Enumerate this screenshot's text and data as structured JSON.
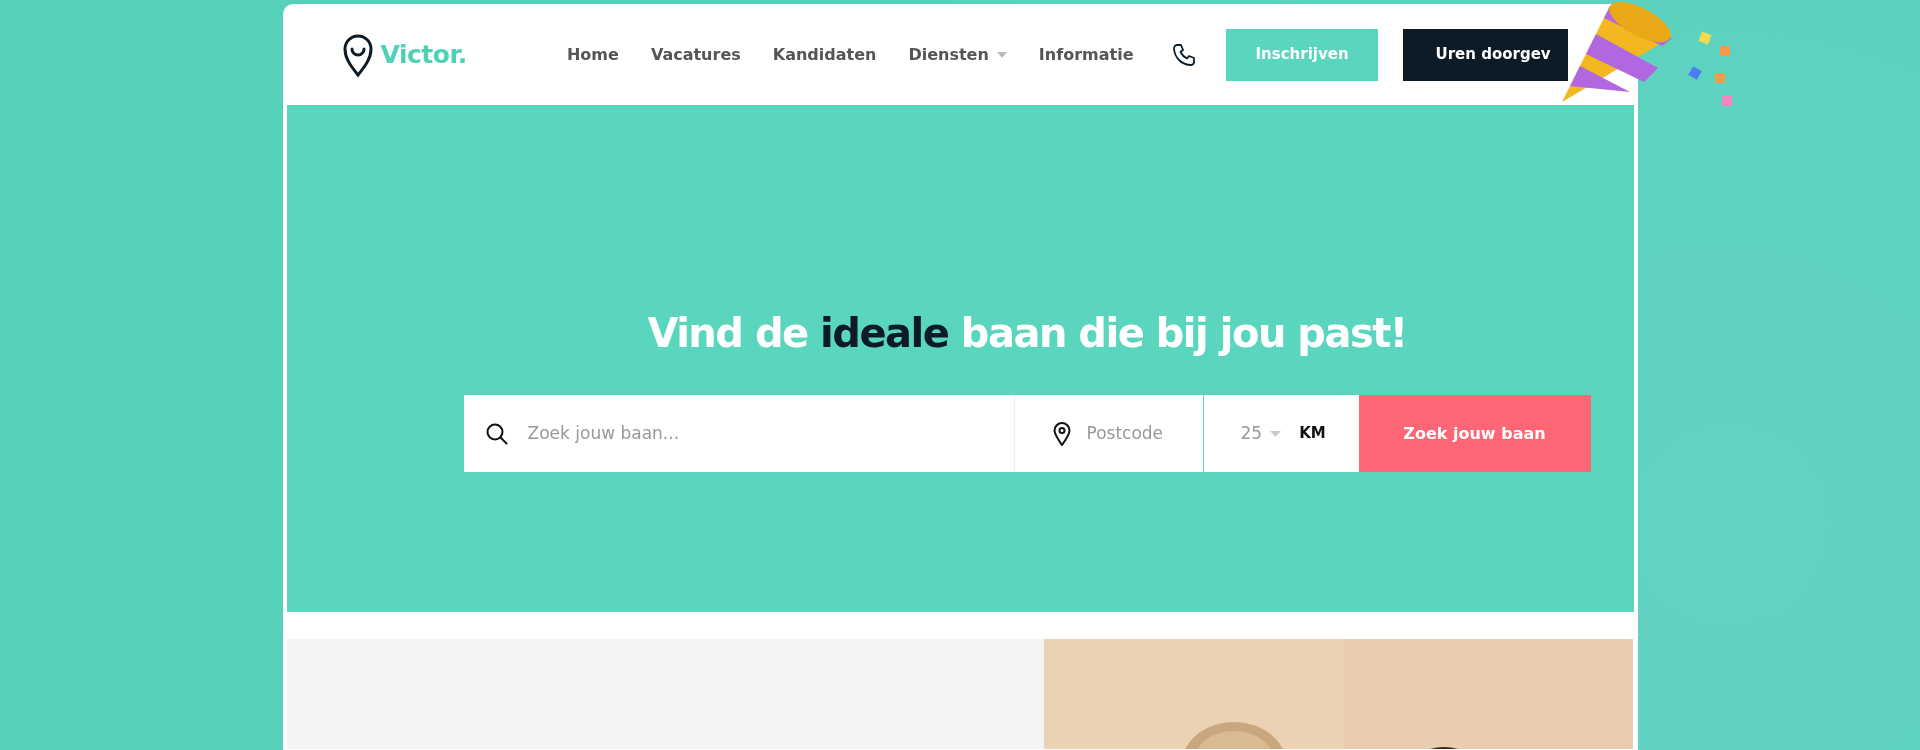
{
  "header": {
    "logo": "Victor.",
    "nav": [
      {
        "label": "Home",
        "dropdown": false
      },
      {
        "label": "Vacatures",
        "dropdown": false
      },
      {
        "label": "Kandidaten",
        "dropdown": false
      },
      {
        "label": "Diensten",
        "dropdown": true
      },
      {
        "label": "Informatie",
        "dropdown": false
      }
    ],
    "buttons": [
      {
        "label": "Inschrijven",
        "kind": "primary"
      },
      {
        "label": "Uren doorgev",
        "kind": "dark"
      }
    ]
  },
  "hero": {
    "heading": "Vind de **ideale** baan die bij jou past!",
    "search": {
      "keyword_placeholder": "Zoek jouw baan...",
      "postcode_placeholder": "Postcode",
      "radius": "25",
      "unit": "KM",
      "button": "Zoek jouw baan"
    }
  }
}
